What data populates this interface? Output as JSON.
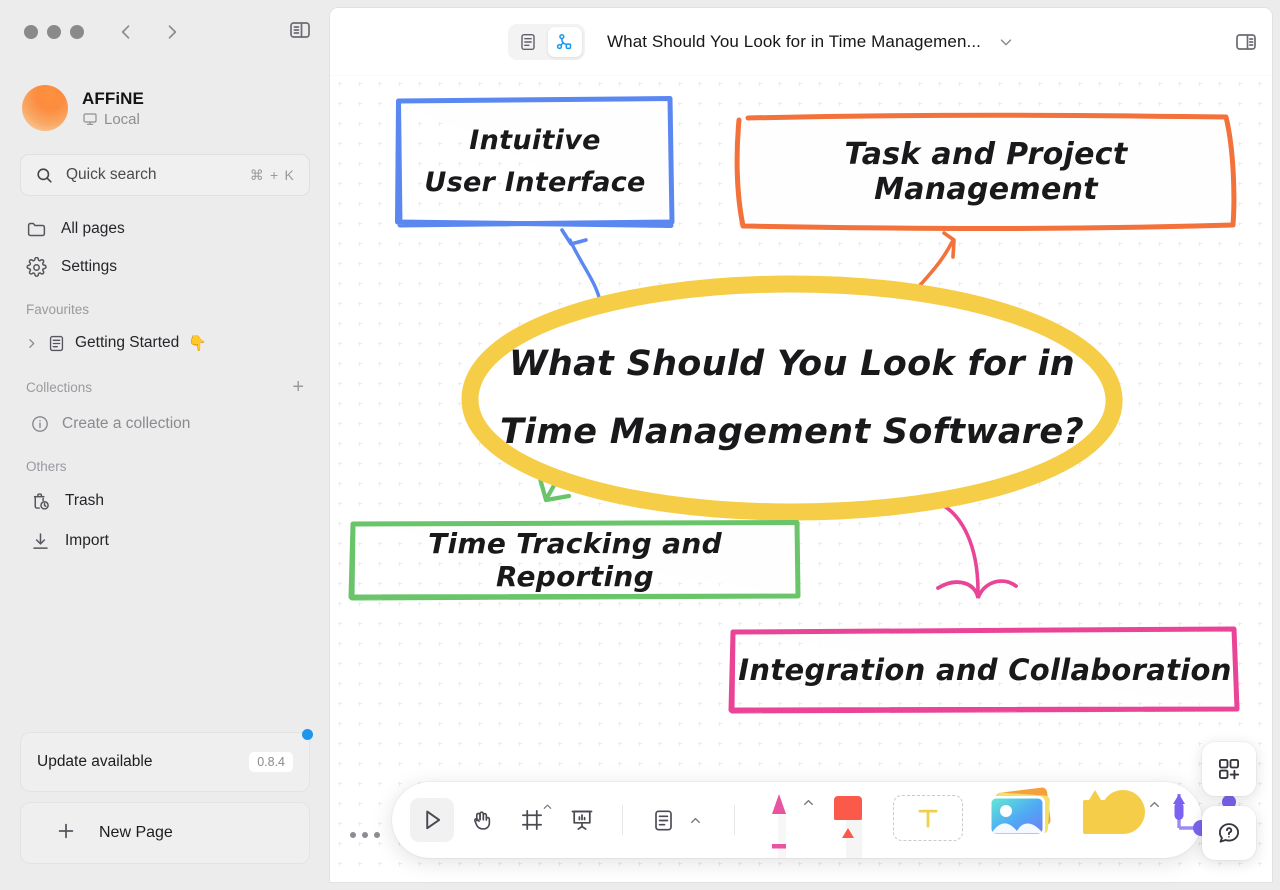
{
  "window": {
    "traffic_lights": [
      "close",
      "minimize",
      "maximize"
    ],
    "back_label": "Back",
    "forward_label": "Forward",
    "sidebar_toggle_label": "Toggle sidebar"
  },
  "sidebar": {
    "workspace": {
      "name": "AFFiNE",
      "sync_status": "Local"
    },
    "search": {
      "placeholder": "Quick search",
      "shortcut": "⌘ + K"
    },
    "nav": [
      {
        "label": "All pages",
        "icon": "folder-icon"
      },
      {
        "label": "Settings",
        "icon": "gear-icon"
      }
    ],
    "sections": {
      "favourites": {
        "title": "Favourites",
        "items": [
          {
            "label": "Getting Started",
            "emoji": "👇",
            "icon": "page-icon"
          }
        ]
      },
      "collections": {
        "title": "Collections",
        "add_label": "+",
        "items": [
          {
            "label": "Create a collection",
            "icon": "info-icon"
          }
        ]
      },
      "others": {
        "title": "Others",
        "items": [
          {
            "label": "Trash",
            "icon": "trash-icon"
          },
          {
            "label": "Import",
            "icon": "import-icon"
          }
        ]
      }
    },
    "update": {
      "label": "Update available",
      "version": "0.8.4"
    },
    "new_page": {
      "label": "New Page"
    }
  },
  "editor": {
    "mode": {
      "page_label": "Page mode",
      "edgeless_label": "Edgeless mode",
      "active": "edgeless"
    },
    "doc_title": "What Should You Look for in Time Managemen...",
    "title_caret_label": "Open doc menu",
    "right_panel_label": "Toggle right sidebar"
  },
  "canvas": {
    "shapes": [
      {
        "id": "intuitive-ui",
        "name": "shape-intuitive-user-interface",
        "color": "#5b87f0",
        "lines": [
          "Intuitive",
          "User Interface"
        ]
      },
      {
        "id": "task-project",
        "name": "shape-task-and-project-management",
        "color": "#f3713a",
        "lines": [
          "Task and Project Management"
        ]
      },
      {
        "id": "center",
        "name": "shape-central-question",
        "color": "#f6cd47",
        "lines": [
          "What Should You Look for in",
          "Time Management Software?"
        ]
      },
      {
        "id": "time-tracking",
        "name": "shape-time-tracking-and-reporting",
        "color": "#69c46a",
        "lines": [
          "Time Tracking and Reporting"
        ]
      },
      {
        "id": "integration",
        "name": "shape-integration-and-collaboration",
        "color": "#ea4497",
        "lines": [
          "Integration and Collaboration"
        ]
      }
    ],
    "connectors": [
      {
        "name": "connector-to-intuitive-ui",
        "color": "#5b87f0"
      },
      {
        "name": "connector-to-task-project",
        "color": "#f3713a"
      },
      {
        "name": "connector-to-time-tracking",
        "color": "#69c46a"
      },
      {
        "name": "connector-to-integration",
        "color": "#ea4497"
      }
    ]
  },
  "toolbar": {
    "more_label": "More options",
    "tools": [
      {
        "name": "select-tool",
        "label": "Select",
        "icon": "cursor-arrow-icon",
        "active": true,
        "caret": false
      },
      {
        "name": "pan-tool",
        "label": "Hand",
        "icon": "hand-icon",
        "active": false,
        "caret": false
      },
      {
        "name": "frame-tool",
        "label": "Frame",
        "icon": "frame-icon",
        "active": false,
        "caret": true
      },
      {
        "name": "present-tool",
        "label": "Present",
        "icon": "presentation-icon",
        "active": false,
        "caret": false
      },
      {
        "name": "note-tool",
        "label": "Note",
        "icon": "note-icon",
        "active": false,
        "caret": true
      }
    ],
    "media_tools": [
      {
        "name": "pen-tool",
        "label": "Pen",
        "icon": "pen-icon",
        "caret": true
      },
      {
        "name": "eraser-tool",
        "label": "Eraser",
        "icon": "eraser-icon",
        "caret": false
      },
      {
        "name": "text-tool",
        "label": "Text",
        "icon": "text-t-icon",
        "caret": false
      },
      {
        "name": "image-tool",
        "label": "Image",
        "icon": "image-icon",
        "caret": false
      },
      {
        "name": "shape-tool",
        "label": "Shape",
        "icon": "shapes-icon",
        "caret": true
      },
      {
        "name": "connector-tool",
        "label": "Connector",
        "icon": "connector-icon",
        "caret": false
      }
    ]
  },
  "corner_buttons": [
    {
      "name": "template-button",
      "label": "Templates",
      "icon": "grid-plus-icon"
    },
    {
      "name": "help-button",
      "label": "Help",
      "icon": "question-bubble-icon"
    }
  ]
}
